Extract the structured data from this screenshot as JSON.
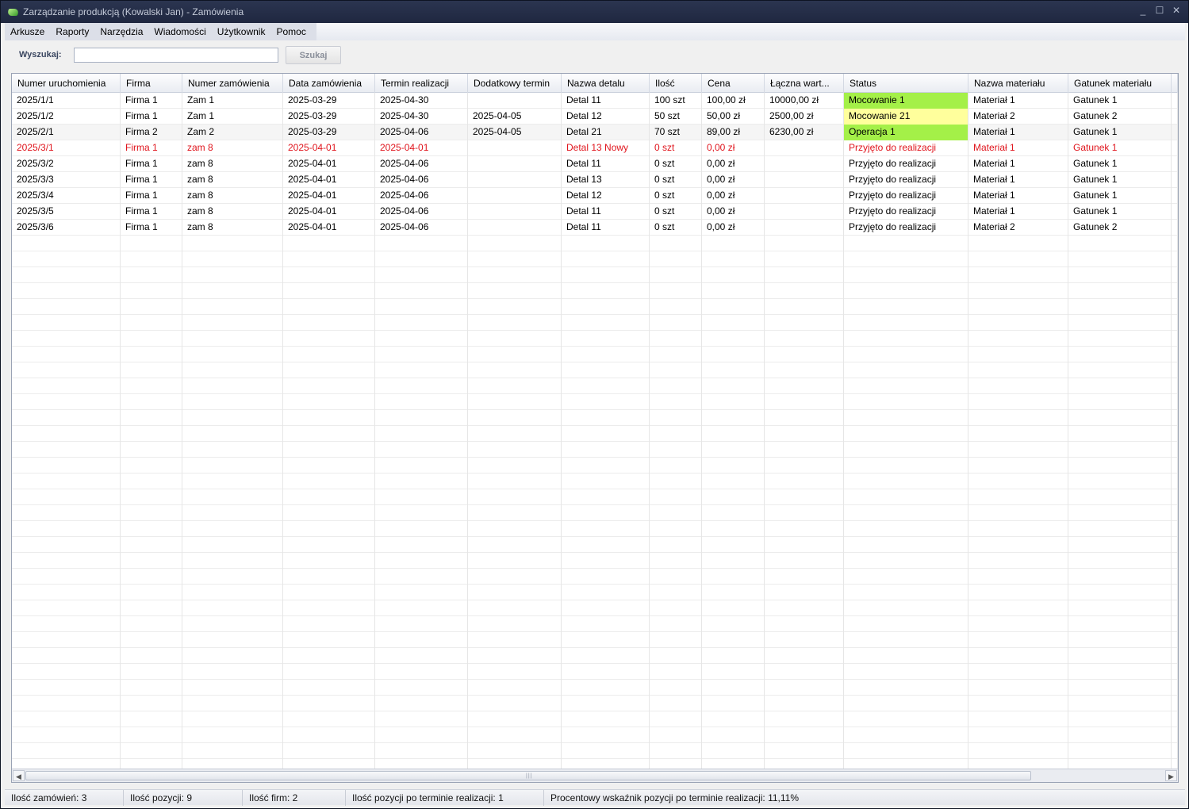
{
  "window": {
    "title": "Zarządzanie produkcją (Kowalski Jan) - Zamówienia",
    "controls": {
      "minimize": "_",
      "maximize": "☐",
      "close": "✕"
    }
  },
  "menu": [
    "Arkusze",
    "Raporty",
    "Narzędzia",
    "Wiadomości",
    "Użytkownik",
    "Pomoc"
  ],
  "search": {
    "label": "Wyszukaj:",
    "value": "",
    "placeholder": "",
    "button": "Szukaj"
  },
  "table": {
    "columns": [
      "Numer uruchomienia",
      "Firma",
      "Numer zamówienia",
      "Data zamówienia",
      "Termin realizacji",
      "Dodatkowy termin",
      "Nazwa detalu",
      "Ilość",
      "Cena",
      "Łączna wart...",
      "Status",
      "Nazwa materiału",
      "Gatunek materiału"
    ],
    "rows": [
      {
        "cells": [
          "2025/1/1",
          "Firma 1",
          "Zam 1",
          "2025-03-29",
          "2025-04-30",
          "",
          "Detal 11",
          "100 szt",
          "100,00 zł",
          "10000,00 zł",
          "Mocowanie 1",
          "Materiał 1",
          "Gatunek 1"
        ],
        "status_color": "green",
        "highlight": ""
      },
      {
        "cells": [
          "2025/1/2",
          "Firma 1",
          "Zam 1",
          "2025-03-29",
          "2025-04-30",
          "2025-04-05",
          "Detal 12",
          "50 szt",
          "50,00 zł",
          "2500,00 zł",
          "Mocowanie 21",
          "Materiał 2",
          "Gatunek 2"
        ],
        "status_color": "yellow",
        "highlight": ""
      },
      {
        "cells": [
          "2025/2/1",
          "Firma 2",
          "Zam 2",
          "2025-03-29",
          "2025-04-06",
          "2025-04-05",
          "Detal 21",
          "70 szt",
          "89,00 zł",
          "6230,00 zł",
          "Operacja 1",
          "Materiał 1",
          "Gatunek 1"
        ],
        "status_color": "green",
        "highlight": ""
      },
      {
        "cells": [
          "2025/3/1",
          "Firma 1",
          "zam 8",
          "2025-04-01",
          "2025-04-01",
          "",
          "Detal 13 Nowy",
          "0 szt",
          "0,00 zł",
          "",
          "Przyjęto do realizacji",
          "Materiał 1",
          "Gatunek 1"
        ],
        "status_color": "",
        "highlight": "red"
      },
      {
        "cells": [
          "2025/3/2",
          "Firma 1",
          "zam 8",
          "2025-04-01",
          "2025-04-06",
          "",
          "Detal 11",
          "0 szt",
          "0,00 zł",
          "",
          "Przyjęto do realizacji",
          "Materiał 1",
          "Gatunek 1"
        ],
        "status_color": "",
        "highlight": ""
      },
      {
        "cells": [
          "2025/3/3",
          "Firma 1",
          "zam 8",
          "2025-04-01",
          "2025-04-06",
          "",
          "Detal 13",
          "0 szt",
          "0,00 zł",
          "",
          "Przyjęto do realizacji",
          "Materiał 1",
          "Gatunek 1"
        ],
        "status_color": "",
        "highlight": ""
      },
      {
        "cells": [
          "2025/3/4",
          "Firma 1",
          "zam 8",
          "2025-04-01",
          "2025-04-06",
          "",
          "Detal 12",
          "0 szt",
          "0,00 zł",
          "",
          "Przyjęto do realizacji",
          "Materiał 1",
          "Gatunek 1"
        ],
        "status_color": "",
        "highlight": ""
      },
      {
        "cells": [
          "2025/3/5",
          "Firma 1",
          "zam 8",
          "2025-04-01",
          "2025-04-06",
          "",
          "Detal 11",
          "0 szt",
          "0,00 zł",
          "",
          "Przyjęto do realizacji",
          "Materiał 1",
          "Gatunek 1"
        ],
        "status_color": "",
        "highlight": ""
      },
      {
        "cells": [
          "2025/3/6",
          "Firma 1",
          "zam 8",
          "2025-04-01",
          "2025-04-06",
          "",
          "Detal 11",
          "0 szt",
          "0,00 zł",
          "",
          "Przyjęto do realizacji",
          "Materiał 2",
          "Gatunek 2"
        ],
        "status_color": "",
        "highlight": ""
      }
    ]
  },
  "colors": {
    "status_green": "#a4f048",
    "status_yellow": "#ffff9c",
    "overdue_text": "#e0141c"
  },
  "statusbar": [
    "Ilość zamówień: 3",
    "Ilość pozycji: 9",
    "Ilość firm: 2",
    "Ilość pozycji po terminie realizacji: 1",
    "Procentowy wskaźnik pozycji po terminie realizacji: 11,11%"
  ]
}
